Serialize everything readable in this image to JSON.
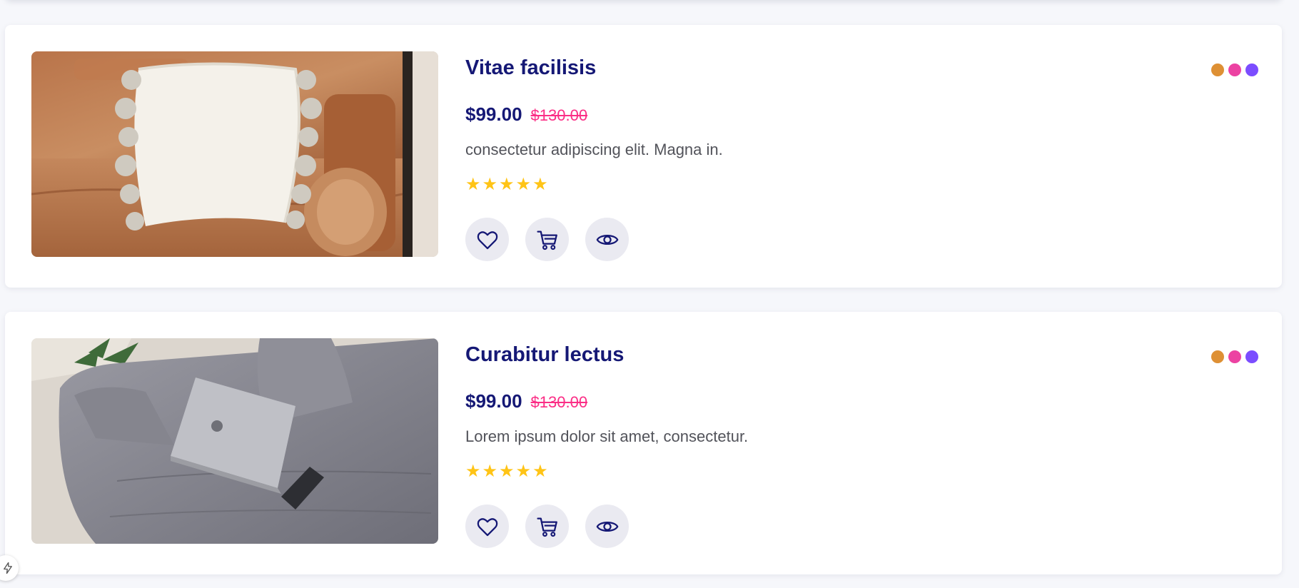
{
  "colors": {
    "title": "#151875",
    "price": "#151875",
    "old_price": "#fb2e86",
    "star": "#ffc416",
    "action_bg": "#eaeaf1"
  },
  "products": [
    {
      "title": "Vitae facilisis",
      "price": "$99.00",
      "old_price": "$130.00",
      "description": "consectetur adipiscing elit. Magna in.",
      "rating": 5,
      "stars": "★★★★★",
      "image_icon": "sofa-with-pillows-image",
      "swatches": [
        "#de9034",
        "#ec42a2",
        "#8568ff"
      ]
    },
    {
      "title": "Curabitur lectus",
      "price": "$99.00",
      "old_price": "$130.00",
      "description": "Lorem ipsum dolor sit amet, consectetur.",
      "rating": 5,
      "stars": "★★★★★",
      "image_icon": "grey-sofa-with-laptop-image",
      "swatches": [
        "#de9034",
        "#ec42a2",
        "#8568ff"
      ]
    }
  ],
  "actions": {
    "wishlist_icon": "heart-icon",
    "cart_icon": "cart-icon",
    "view_icon": "eye-icon"
  },
  "badge_icon": "lightning-icon"
}
